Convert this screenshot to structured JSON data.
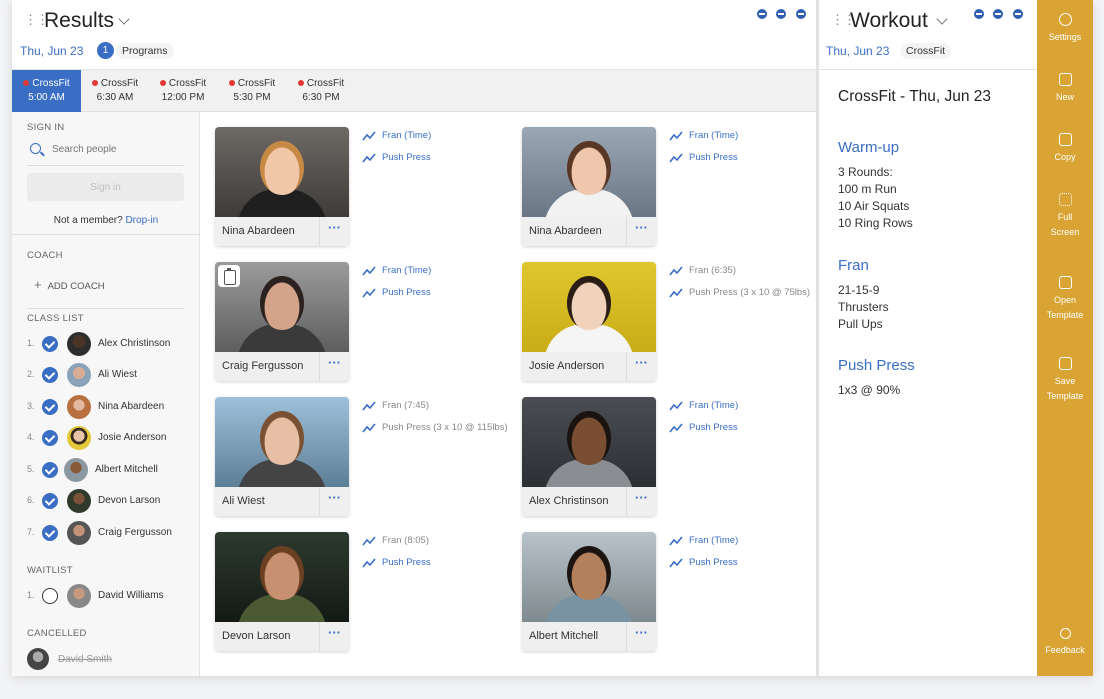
{
  "results_panel": {
    "title": "Results",
    "date": "Thu, Jun 23",
    "programs_count": "1",
    "programs_label": "Programs"
  },
  "class_tabs": [
    {
      "label": "CrossFit",
      "time": "5:00 AM",
      "active": true
    },
    {
      "label": "CrossFit",
      "time": "6:30 AM",
      "active": false
    },
    {
      "label": "CrossFit",
      "time": "12:00 PM",
      "active": false
    },
    {
      "label": "CrossFit",
      "time": "5:30 PM",
      "active": false
    },
    {
      "label": "CrossFit",
      "time": "6:30 PM",
      "active": false
    }
  ],
  "sidebar": {
    "sign_in_heading": "SIGN IN",
    "search_placeholder": "Search people",
    "sign_in_button": "Sign in",
    "not_member_text": "Not a member?",
    "drop_in_link": "Drop-in",
    "coach_heading": "COACH",
    "add_coach": "ADD COACH",
    "class_list_heading": "CLASS LIST",
    "class_list": [
      {
        "num": "1.",
        "name": "Alex Christinson"
      },
      {
        "num": "2.",
        "name": "Ali Wiest"
      },
      {
        "num": "3.",
        "name": "Nina Abardeen"
      },
      {
        "num": "4.",
        "name": "Josie Anderson"
      },
      {
        "num": "5.",
        "name": "Albert Mitchell"
      },
      {
        "num": "6.",
        "name": "Devon Larson"
      },
      {
        "num": "7.",
        "name": "Craig Fergusson"
      }
    ],
    "waitlist_heading": "WAITLIST",
    "waitlist": [
      {
        "num": "1.",
        "name": "David Williams"
      }
    ],
    "cancelled_heading": "CANCELLED",
    "cancelled": [
      {
        "name": "David Smith"
      }
    ]
  },
  "athletes": [
    {
      "name": "Nina Abardeen",
      "result1": "Fran (Time)",
      "result2": "Push Press",
      "r1_recorded": false,
      "r2_recorded": false
    },
    {
      "name": "Nina Abardeen",
      "result1": "Fran (Time)",
      "result2": "Push Press",
      "r1_recorded": false,
      "r2_recorded": false
    },
    {
      "name": "Craig Fergusson",
      "result1": "Fran (Time)",
      "result2": "Push Press",
      "r1_recorded": false,
      "r2_recorded": false
    },
    {
      "name": "Josie Anderson",
      "result1": "Fran (6:35)",
      "result2": "Push Press (3 x 10 @ 75lbs)",
      "r1_recorded": true,
      "r2_recorded": true
    },
    {
      "name": "Ali Wiest",
      "result1": "Fran (7:45)",
      "result2": "Push Press (3 x 10 @ 115lbs)",
      "r1_recorded": true,
      "r2_recorded": true
    },
    {
      "name": "Alex Christinson",
      "result1": "Fran (Time)",
      "result2": "Push Press",
      "r1_recorded": false,
      "r2_recorded": false
    },
    {
      "name": "Devon Larson",
      "result1": "Fran (8:05)",
      "result2": "Push Press",
      "r1_recorded": true,
      "r2_recorded": false
    },
    {
      "name": "Albert Mitchell",
      "result1": "Fran (Time)",
      "result2": "Push Press",
      "r1_recorded": false,
      "r2_recorded": false
    }
  ],
  "workout_panel": {
    "title": "Workout",
    "date": "Thu, Jun 23",
    "program": "CrossFit",
    "heading": "CrossFit - Thu, Jun 23",
    "sections": [
      {
        "title": "Warm-up",
        "lines": [
          "3 Rounds:",
          "100 m Run",
          "10 Air Squats",
          "10 Ring Rows"
        ]
      },
      {
        "title": "Fran",
        "lines": [
          "21-15-9",
          "Thrusters",
          "Pull Ups"
        ]
      },
      {
        "title": "Push Press",
        "lines": [
          "1x3 @ 90%"
        ]
      }
    ]
  },
  "right_bar": {
    "settings": "Settings",
    "new": "New",
    "copy": "Copy",
    "full_screen_1": "Full",
    "full_screen_2": "Screen",
    "open_template_1": "Open",
    "open_template_2": "Template",
    "save_template_1": "Save",
    "save_template_2": "Template",
    "feedback": "Feedback"
  },
  "colors": {
    "accent": "#3a6ec4",
    "sidebar_gold": "#d9a433",
    "tab_dot": "#e53935"
  }
}
